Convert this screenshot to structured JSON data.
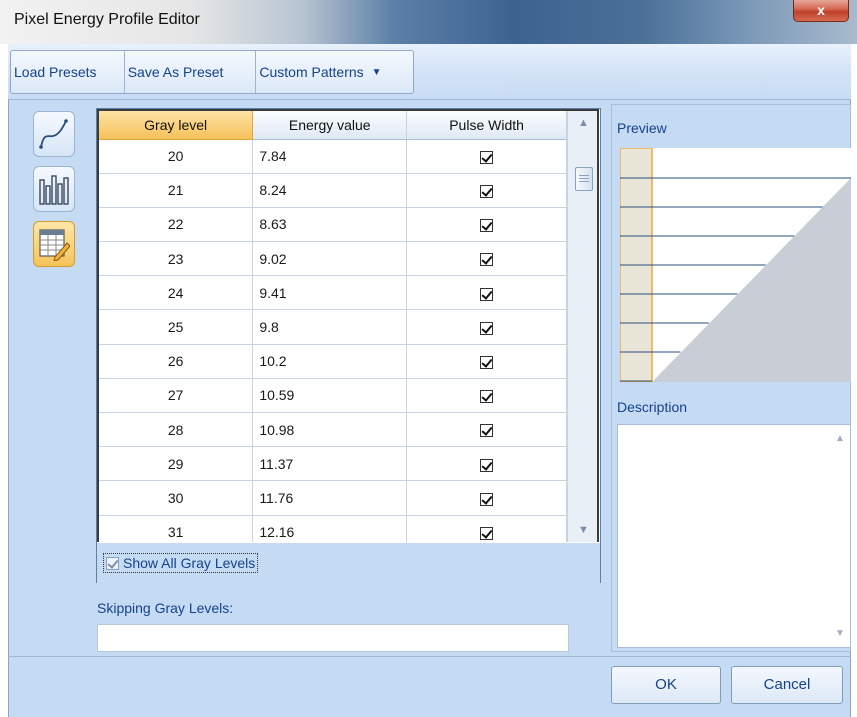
{
  "window": {
    "title": "Pixel Energy Profile Editor",
    "close_glyph": "x"
  },
  "toolbar": {
    "load_label": "Load Presets",
    "save_label": "Save As Preset",
    "custom_label": "Custom Patterns",
    "custom_arrow": "▼"
  },
  "grid": {
    "columns": [
      "Gray level",
      "Energy value",
      "Pulse Width"
    ],
    "rows": [
      {
        "gray": "20",
        "energy": "7.84",
        "pulse": true
      },
      {
        "gray": "21",
        "energy": "8.24",
        "pulse": true
      },
      {
        "gray": "22",
        "energy": "8.63",
        "pulse": true
      },
      {
        "gray": "23",
        "energy": "9.02",
        "pulse": true
      },
      {
        "gray": "24",
        "energy": "9.41",
        "pulse": true
      },
      {
        "gray": "25",
        "energy": "9.8",
        "pulse": true
      },
      {
        "gray": "26",
        "energy": "10.2",
        "pulse": true
      },
      {
        "gray": "27",
        "energy": "10.59",
        "pulse": true
      },
      {
        "gray": "28",
        "energy": "10.98",
        "pulse": true
      },
      {
        "gray": "29",
        "energy": "11.37",
        "pulse": true
      },
      {
        "gray": "30",
        "energy": "11.76",
        "pulse": true
      },
      {
        "gray": "31",
        "energy": "12.16",
        "pulse": true
      }
    ],
    "show_all_label": "Show All Gray Levels",
    "show_all_checked": true
  },
  "skipping": {
    "label": "Skipping Gray Levels:",
    "value": ""
  },
  "preview": {
    "label": "Preview"
  },
  "description": {
    "label": "Description",
    "value": ""
  },
  "buttons": {
    "ok": "OK",
    "cancel": "Cancel"
  },
  "icons": {
    "rail": [
      "curve-icon",
      "bar-chart-icon",
      "table-edit-icon"
    ]
  },
  "colors": {
    "accent": "#15428b",
    "selected_header": "#f6c25a",
    "background": "#c5dbf4"
  }
}
